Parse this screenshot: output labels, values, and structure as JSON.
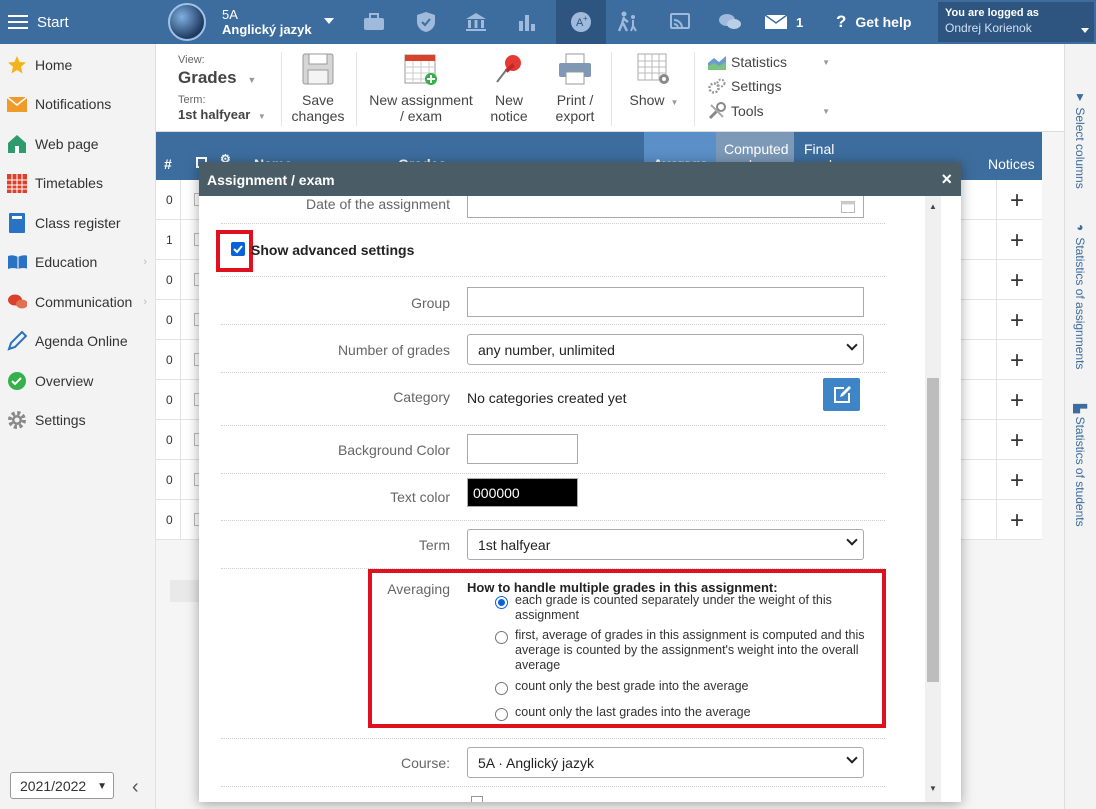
{
  "topbar": {
    "start_label": "Start",
    "class_name": "5A",
    "subject": "Anglický jazyk",
    "messages_count": "1",
    "help_label": "Get help",
    "logged_label": "You are logged as",
    "user_name": "Ondrej Korienok",
    "icons": [
      "briefcase-icon",
      "shield-icon",
      "bank-icon",
      "bar-chart-icon",
      "grades-icon",
      "walking-icon",
      "cast-icon",
      "chat-icon",
      "mail-icon",
      "question-icon"
    ]
  },
  "sidebar": {
    "items": [
      {
        "label": "Home",
        "icon": "star-icon"
      },
      {
        "label": "Notifications",
        "icon": "envelope-icon"
      },
      {
        "label": "Web page",
        "icon": "house-icon"
      },
      {
        "label": "Timetables",
        "icon": "calendar-icon"
      },
      {
        "label": "Class register",
        "icon": "book-icon"
      },
      {
        "label": "Education",
        "icon": "open-book-icon",
        "arrow": "›"
      },
      {
        "label": "Communication",
        "icon": "chat-bubbles-icon",
        "arrow": "›"
      },
      {
        "label": "Agenda Online",
        "icon": "pen-icon"
      },
      {
        "label": "Overview",
        "icon": "check-circle-icon"
      },
      {
        "label": "Settings",
        "icon": "gear-icon"
      }
    ],
    "year": "2021/2022",
    "collapse_glyph": "‹"
  },
  "toolbar": {
    "view_label": "View:",
    "view_value": "Grades",
    "term_label": "Term:",
    "term_value": "1st halfyear",
    "save_label_1": "Save",
    "save_label_2": "changes",
    "new_assignment_1": "New assignment",
    "new_assignment_2": "/ exam",
    "new_notice_1": "New",
    "new_notice_2": "notice",
    "print_1": "Print /",
    "print_2": "export",
    "show_label": "Show",
    "statistics_label": "Statistics",
    "settings_label": "Settings",
    "tools_label": "Tools"
  },
  "rightbar": {
    "select_columns": "Select columns",
    "stats_assignments": "Statistics of assignments",
    "stats_students": "Statistics of students"
  },
  "table": {
    "col_hash": "#",
    "col_name": "Name",
    "col_grades": "Grades",
    "col_average": "Average",
    "col_computed": "Computed grade",
    "col_final": "Final grade",
    "col_notices": "Notices",
    "row_numbers": [
      "0",
      "1",
      "0",
      "0",
      "0",
      "0",
      "0",
      "0",
      "0"
    ]
  },
  "modal": {
    "title": "Assignment / exam",
    "close": "×",
    "date_label": "Date of the assignment",
    "advanced_label": "Show advanced settings",
    "group_label": "Group",
    "group_value": "",
    "numgrades_label": "Number of grades",
    "numgrades_value": "any number, unlimited",
    "category_label": "Category",
    "category_value": "No categories created yet",
    "bg_color_label": "Background Color",
    "text_color_label": "Text color",
    "text_color_value": "000000",
    "term_label": "Term",
    "term_value": "1st halfyear",
    "averaging_label": "Averaging",
    "averaging_heading": "How to handle multiple grades in this assignment:",
    "averaging_options": [
      {
        "text": "each grade is counted separately under the weight of this assignment",
        "selected": true
      },
      {
        "text": "first, average of grades in this assignment is computed and this average is counted by the assignment's weight into the overall average",
        "selected": false
      },
      {
        "text": "count only the best grade into the average",
        "selected": false
      },
      {
        "text": "count only the last grades into the average",
        "selected": false
      }
    ],
    "course_label": "Course:",
    "course_value": "5A · Anglický jazyk"
  },
  "colors": {
    "primary": "#3d6d9e",
    "highlight": "#e0111f",
    "modal_header": "#4a5d66",
    "edit_button": "#3d85c6"
  }
}
